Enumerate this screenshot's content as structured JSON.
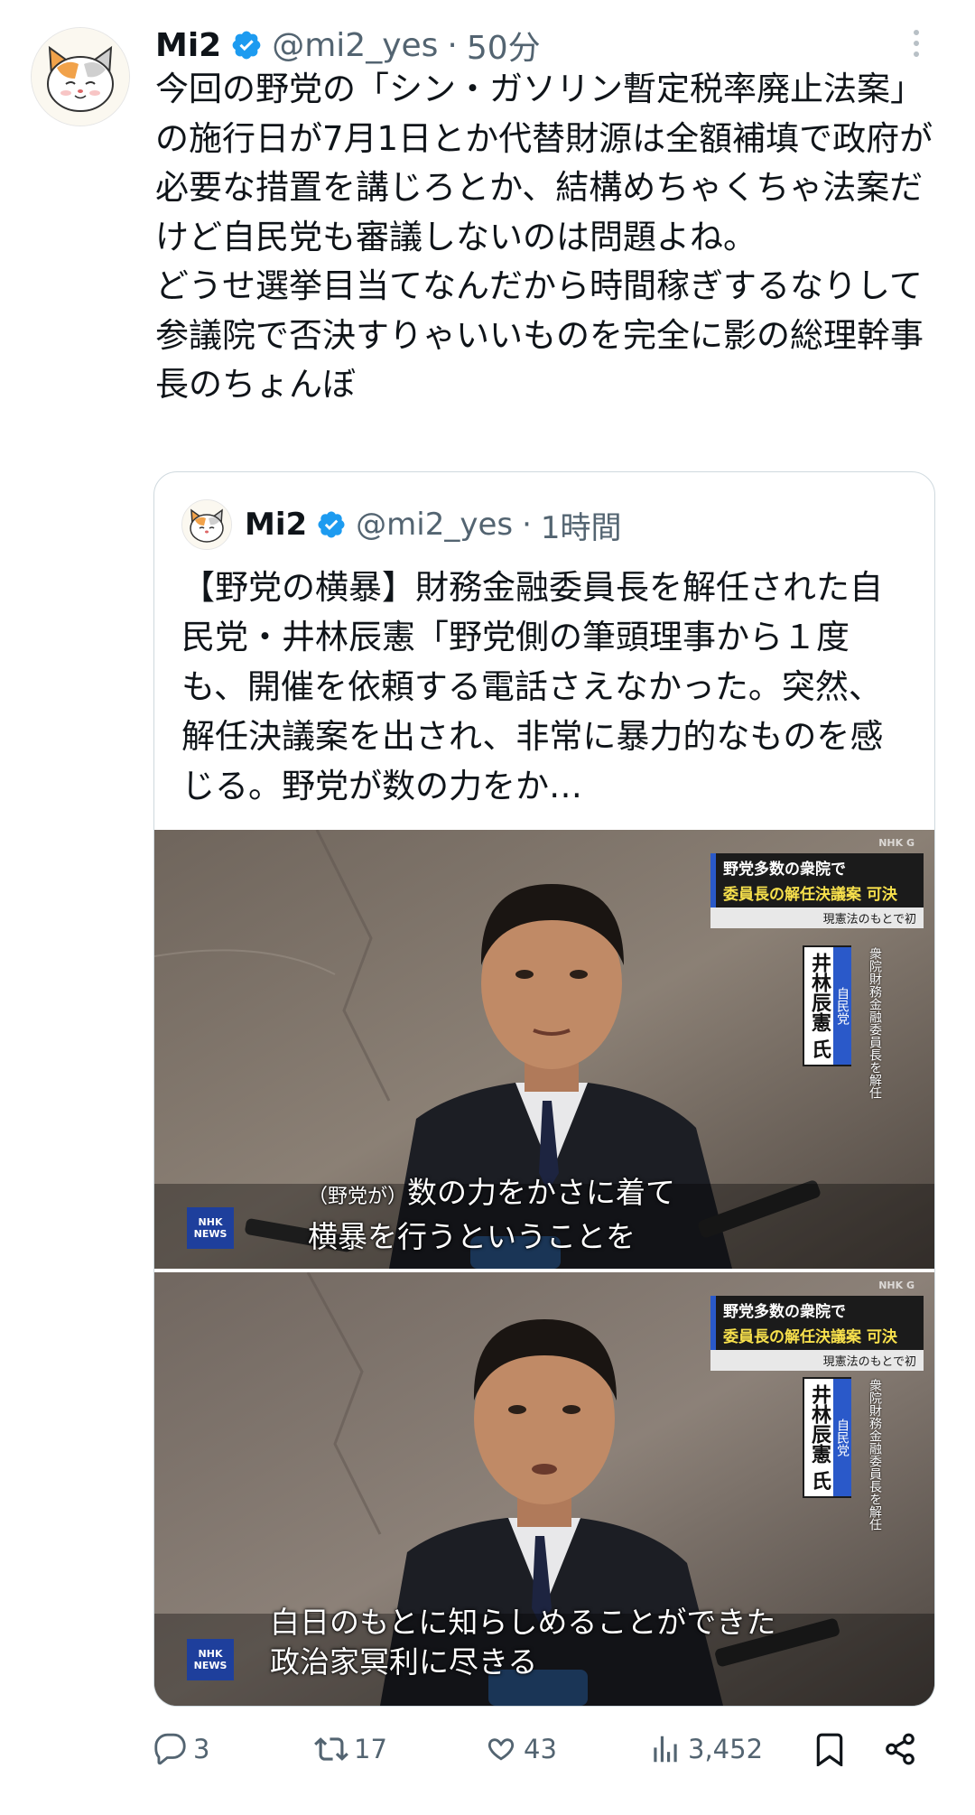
{
  "tweet": {
    "author_name": "Mi2",
    "handle": "@mi2_yes",
    "separator": "·",
    "time": "50分",
    "text": "今回の野党の「シン・ガソリン暫定税率廃止法案」の施行日が7月1日とか代替財源は全額補填で政府が必要な措置を講じろとか、結構めちゃくちゃ法案だけど自民党も審議しないのは問題よね。\nどうせ選挙目当てなんだから時間稼ぎするなりして参議院で否決すりゃいいものを完全に影の総理幹事長のちょんぼ"
  },
  "quote": {
    "author_name": "Mi2",
    "handle": "@mi2_yes",
    "separator": "·",
    "time": "1時間",
    "text": "【野党の横暴】財務金融委員長を解任された自民党・井林辰憲「野党側の筆頭理事から１度も、開催を依頼する電話さえなかった。突然、解任決議案を出され、非常に暴力的なものを感じる。野党が数の力をか…"
  },
  "media": [
    {
      "banner_line1": "野党多数の衆院で",
      "banner_line2": "委員長の解任決議案 可決",
      "banner_line3": "現憲法のもとで初",
      "party": "自民党",
      "person": "井林辰憲 氏",
      "role": "衆院財務金融委員長を解任",
      "caption_small": "（野党が）",
      "caption_line1": "数の力をかさに着て",
      "caption_line2": "横暴を行うということを",
      "logo_line1": "NHK",
      "logo_line2": "NEWS",
      "corner": "NHK G"
    },
    {
      "banner_line1": "野党多数の衆院で",
      "banner_line2": "委員長の解任決議案 可決",
      "banner_line3": "現憲法のもとで初",
      "party": "自民党",
      "person": "井林辰憲 氏",
      "role": "衆院財務金融委員長を解任",
      "caption_line1": "白日のもとに知らしめることができた",
      "caption_line2": "政治家冥利に尽きる",
      "logo_line1": "NHK",
      "logo_line2": "NEWS",
      "corner": "NHK G"
    }
  ],
  "actions": {
    "reply_count": "3",
    "retweet_count": "17",
    "like_count": "43",
    "views_count": "3,452"
  },
  "icons": {
    "verified": "verified-badge-icon",
    "more": "more-vertical-icon",
    "reply": "reply-icon",
    "retweet": "retweet-icon",
    "like": "heart-icon",
    "views": "views-icon",
    "bookmark": "bookmark-icon",
    "share": "share-icon"
  },
  "colors": {
    "verified": "#1d9bf0",
    "secondary_text": "#536471",
    "border": "#cfd9de"
  }
}
